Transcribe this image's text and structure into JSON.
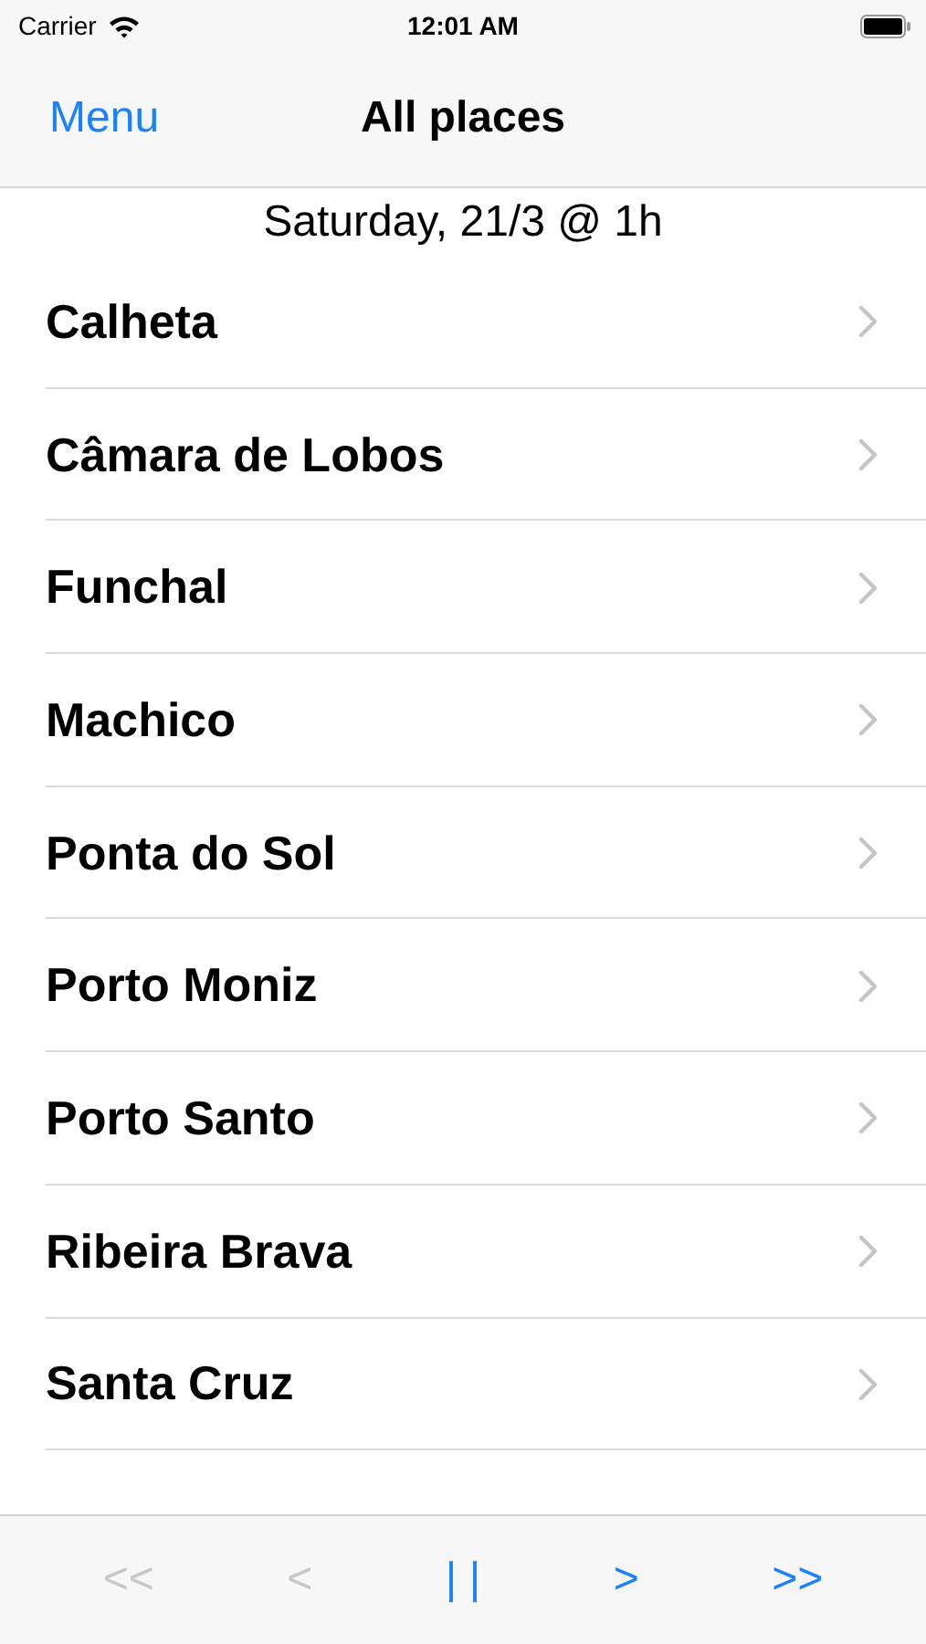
{
  "status_bar": {
    "carrier": "Carrier",
    "time": "12:01 AM"
  },
  "nav_bar": {
    "left_button": "Menu",
    "title": "All places"
  },
  "date_header": "Saturday, 21/3 @ 1h",
  "places": [
    {
      "name": "Calheta"
    },
    {
      "name": "Câmara de Lobos"
    },
    {
      "name": "Funchal"
    },
    {
      "name": "Machico"
    },
    {
      "name": "Ponta do Sol"
    },
    {
      "name": "Porto Moniz"
    },
    {
      "name": "Porto Santo"
    },
    {
      "name": "Ribeira Brava"
    },
    {
      "name": "Santa Cruz"
    }
  ],
  "toolbar": [
    {
      "label": "<<",
      "disabled": true
    },
    {
      "label": "<",
      "disabled": true
    },
    {
      "label": "| |",
      "disabled": false
    },
    {
      "label": ">",
      "disabled": false
    },
    {
      "label": ">>",
      "disabled": false
    }
  ]
}
